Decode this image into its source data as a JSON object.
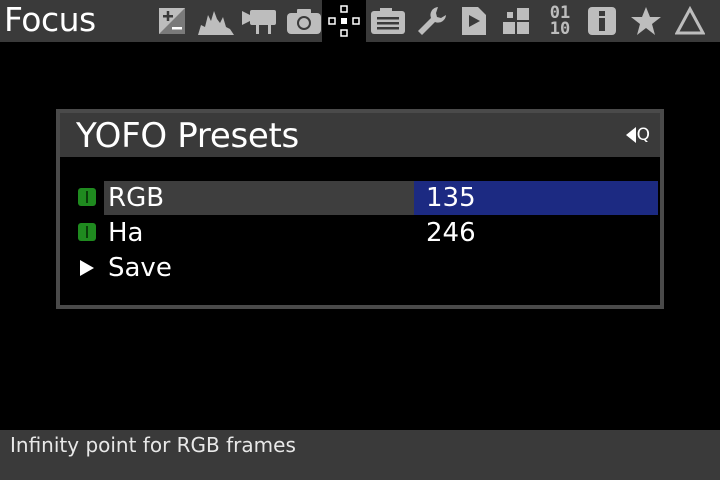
{
  "header": {
    "title": "Focus",
    "tabs": [
      {
        "name": "exposure-compensation-icon",
        "active": false
      },
      {
        "name": "histogram-icon",
        "active": false
      },
      {
        "name": "video-camera-icon",
        "active": false
      },
      {
        "name": "camera-icon",
        "active": false
      },
      {
        "name": "focus-crosshair-icon",
        "active": true
      },
      {
        "name": "memo-card-icon",
        "active": false
      },
      {
        "name": "wrench-icon",
        "active": false
      },
      {
        "name": "file-play-icon",
        "active": false
      },
      {
        "name": "blocks-icon",
        "active": false
      },
      {
        "name": "binary-icon",
        "active": false
      },
      {
        "name": "info-icon",
        "active": false
      },
      {
        "name": "star-icon",
        "active": false
      },
      {
        "name": "triangle-icon",
        "active": false
      }
    ],
    "binary_top": "01",
    "binary_bottom": "10"
  },
  "dialog": {
    "title": "YOFO Presets",
    "back_key": "Q",
    "rows": [
      {
        "label": "RGB",
        "value": "135",
        "selected": true,
        "lamp": "green"
      },
      {
        "label": "Ha",
        "value": "246",
        "selected": false,
        "lamp": "green"
      },
      {
        "label": "Save",
        "value": "",
        "selected": false,
        "lamp": "none"
      }
    ]
  },
  "status": {
    "text": "Infinity point for RGB frames"
  },
  "colors": {
    "bar": "#3a3a3a",
    "selection_blue": "#1c2a82",
    "lamp_green": "#1f8a1f"
  }
}
